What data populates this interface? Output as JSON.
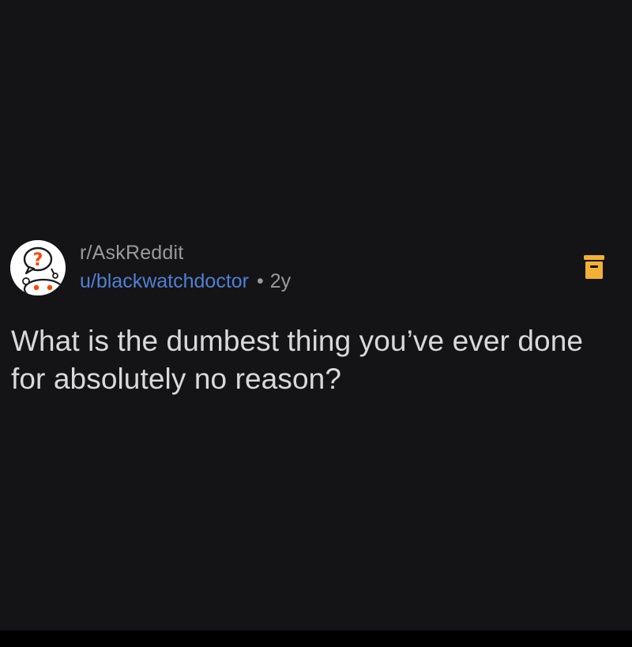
{
  "post": {
    "subreddit": "r/AskReddit",
    "username": "u/blackwatchdoctor",
    "separator": "•",
    "age": "2y",
    "title": "What is the dumbest thing you’ve ever done for absolutely no reason?"
  },
  "icons": {
    "avatar": "askreddit-snoo-question-icon",
    "archive": "archive-box-icon"
  },
  "colors": {
    "background": "#141416",
    "username": "#4f7fd6",
    "meta_text": "#9a9a9c",
    "title_text": "#d9d9db",
    "archive_icon": "#f2b134"
  }
}
